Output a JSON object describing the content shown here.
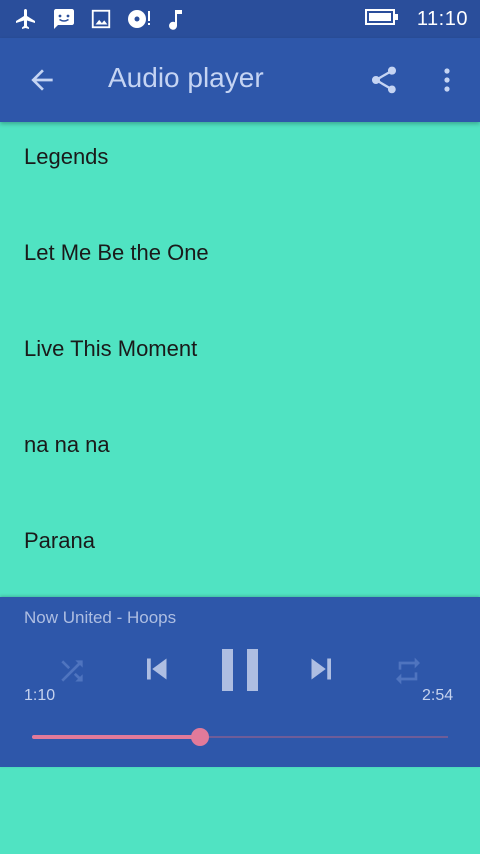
{
  "status_bar": {
    "time": "11:10",
    "icons": [
      "airplane-icon",
      "message-icon",
      "image-icon",
      "media-download-icon",
      "music-note-icon",
      "battery-icon"
    ]
  },
  "app_bar": {
    "title": "Audio player",
    "icons": [
      "back-arrow-icon",
      "share-icon",
      "more-vert-icon"
    ]
  },
  "tracks": [
    "Legends",
    "Let Me Be the One",
    "Live This Moment",
    "na na na",
    "Parana"
  ],
  "player": {
    "now_playing": "Now United - Hoops",
    "elapsed": "1:10",
    "duration": "2:54",
    "progress": 0.405,
    "controls": [
      "shuffle-icon",
      "previous-icon",
      "pause-icon",
      "next-icon",
      "repeat-icon"
    ]
  },
  "colors": {
    "background": "#50e3c2",
    "app_bar": "#2e57aa",
    "status_bar": "#2a4e9b",
    "accent": "#e17a9a"
  }
}
